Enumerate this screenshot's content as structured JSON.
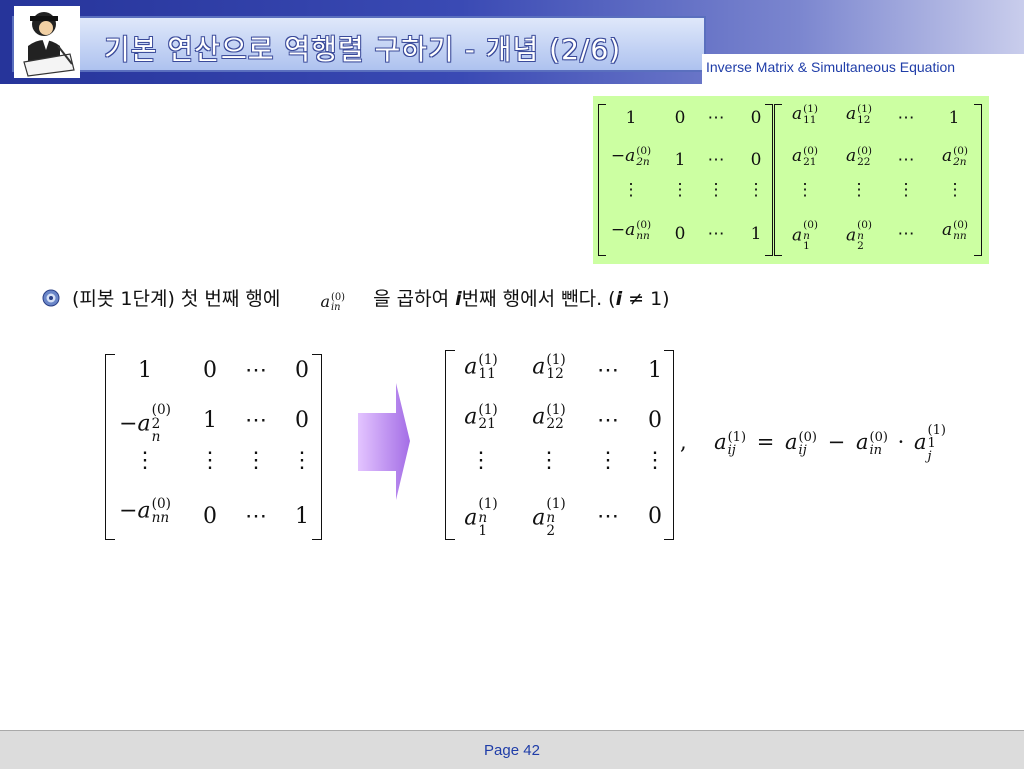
{
  "header": {
    "title": "기본 연산으로 역행렬 구하기 - 개념 (2/6)",
    "subtitle": "Inverse Matrix & Simultaneous Equation"
  },
  "bullet": {
    "part1": "(피봇 1단계) 첫 번째 행에",
    "part2": "을 곱하여",
    "part3": "i",
    "part4": "번째 행에서 뺀다. (",
    "part5": "i",
    "part6": " ≠ 1)"
  },
  "equation": {
    "comma": ","
  },
  "footer": {
    "page": "Page 42"
  },
  "colors": {
    "header_dark": "#26349a",
    "green_panel": "#ccffa2",
    "arrow": "#c89af5",
    "link_blue": "#1f3da8"
  }
}
